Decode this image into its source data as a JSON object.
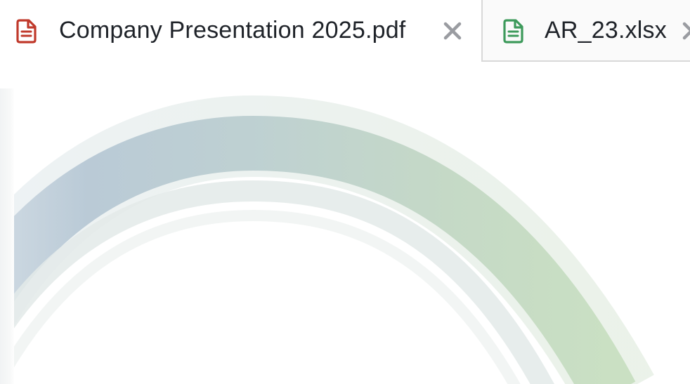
{
  "tabs": [
    {
      "label": "Company Presentation 2025.pdf",
      "file_type": "pdf",
      "icon": "pdf-file-icon",
      "icon_color": "#c0392b",
      "active": true,
      "close_icon": "close-icon"
    },
    {
      "label": "AR_23.xlsx",
      "file_type": "xlsx",
      "icon": "spreadsheet-file-icon",
      "icon_color": "#3d9a5b",
      "active": false,
      "close_icon": "close-icon"
    }
  ],
  "colors": {
    "close_icon": "#9a9ca1",
    "arc_blue": "#b9c9d6",
    "arc_green": "#c6dbc2",
    "tab_border": "#d8d8d8"
  }
}
